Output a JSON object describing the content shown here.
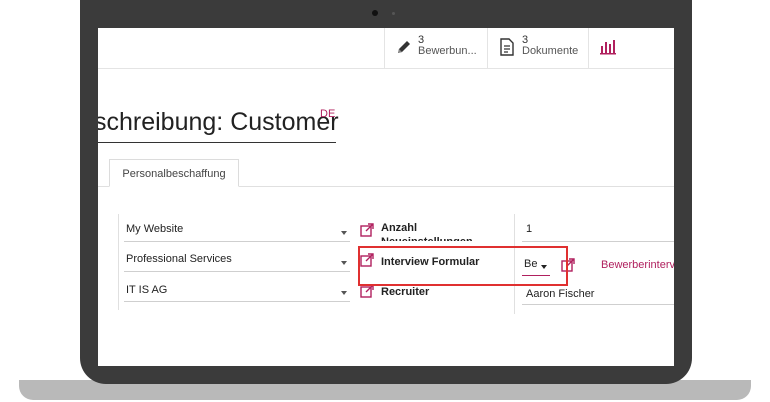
{
  "header": {
    "stats": [
      {
        "count": "3",
        "label": "Bewerbun...",
        "icon": "pencil-icon"
      },
      {
        "count": "3",
        "label": "Dokumente",
        "icon": "document-icon"
      },
      {
        "icon": "bar-chart-icon"
      }
    ]
  },
  "form": {
    "title": "schreibung: Customer",
    "lang_badge": "DE",
    "tabs": [
      {
        "label": "Personalbeschaffung"
      }
    ],
    "left_fields": [
      {
        "value": "My Website"
      },
      {
        "value": "Professional Services"
      },
      {
        "value": "IT IS AG"
      }
    ],
    "right_labels": [
      {
        "label": "Anzahl Neueinstellungen"
      },
      {
        "label": "Interview Formular"
      },
      {
        "label": "Recruiter"
      }
    ],
    "right_values": {
      "hires": "1",
      "interview_select": "Be",
      "interview_link": "Bewerberinterv",
      "recruiter": "Aaron Fischer"
    }
  },
  "colors": {
    "accent": "#b0205e",
    "highlight": "#e03030",
    "bezel": "#3b3b3b"
  }
}
